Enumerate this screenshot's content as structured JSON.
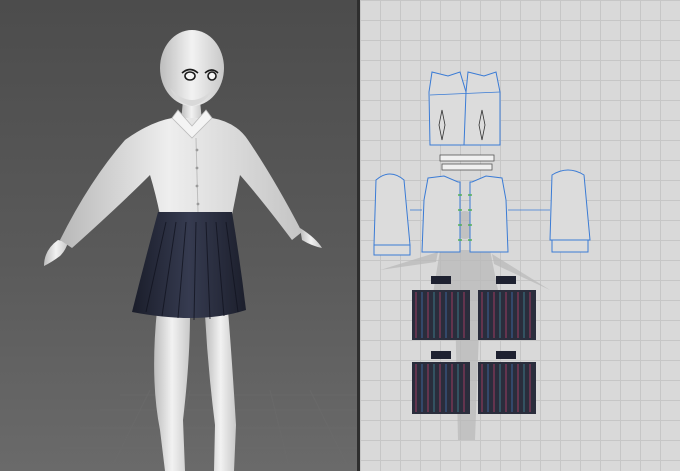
{
  "app": {
    "views": [
      "3d-view",
      "2d-pattern-view"
    ]
  },
  "colors": {
    "viewport_3d_background": "#555555",
    "viewport_2d_background": "#d9d9d9",
    "pattern_outline": "#3a7bd5",
    "shirt_fabric": "#e6e6e6",
    "skirt_fabric": "#262a3a",
    "avatar_skin": "#e8e8e8",
    "selected_piece": "#4caf50"
  }
}
